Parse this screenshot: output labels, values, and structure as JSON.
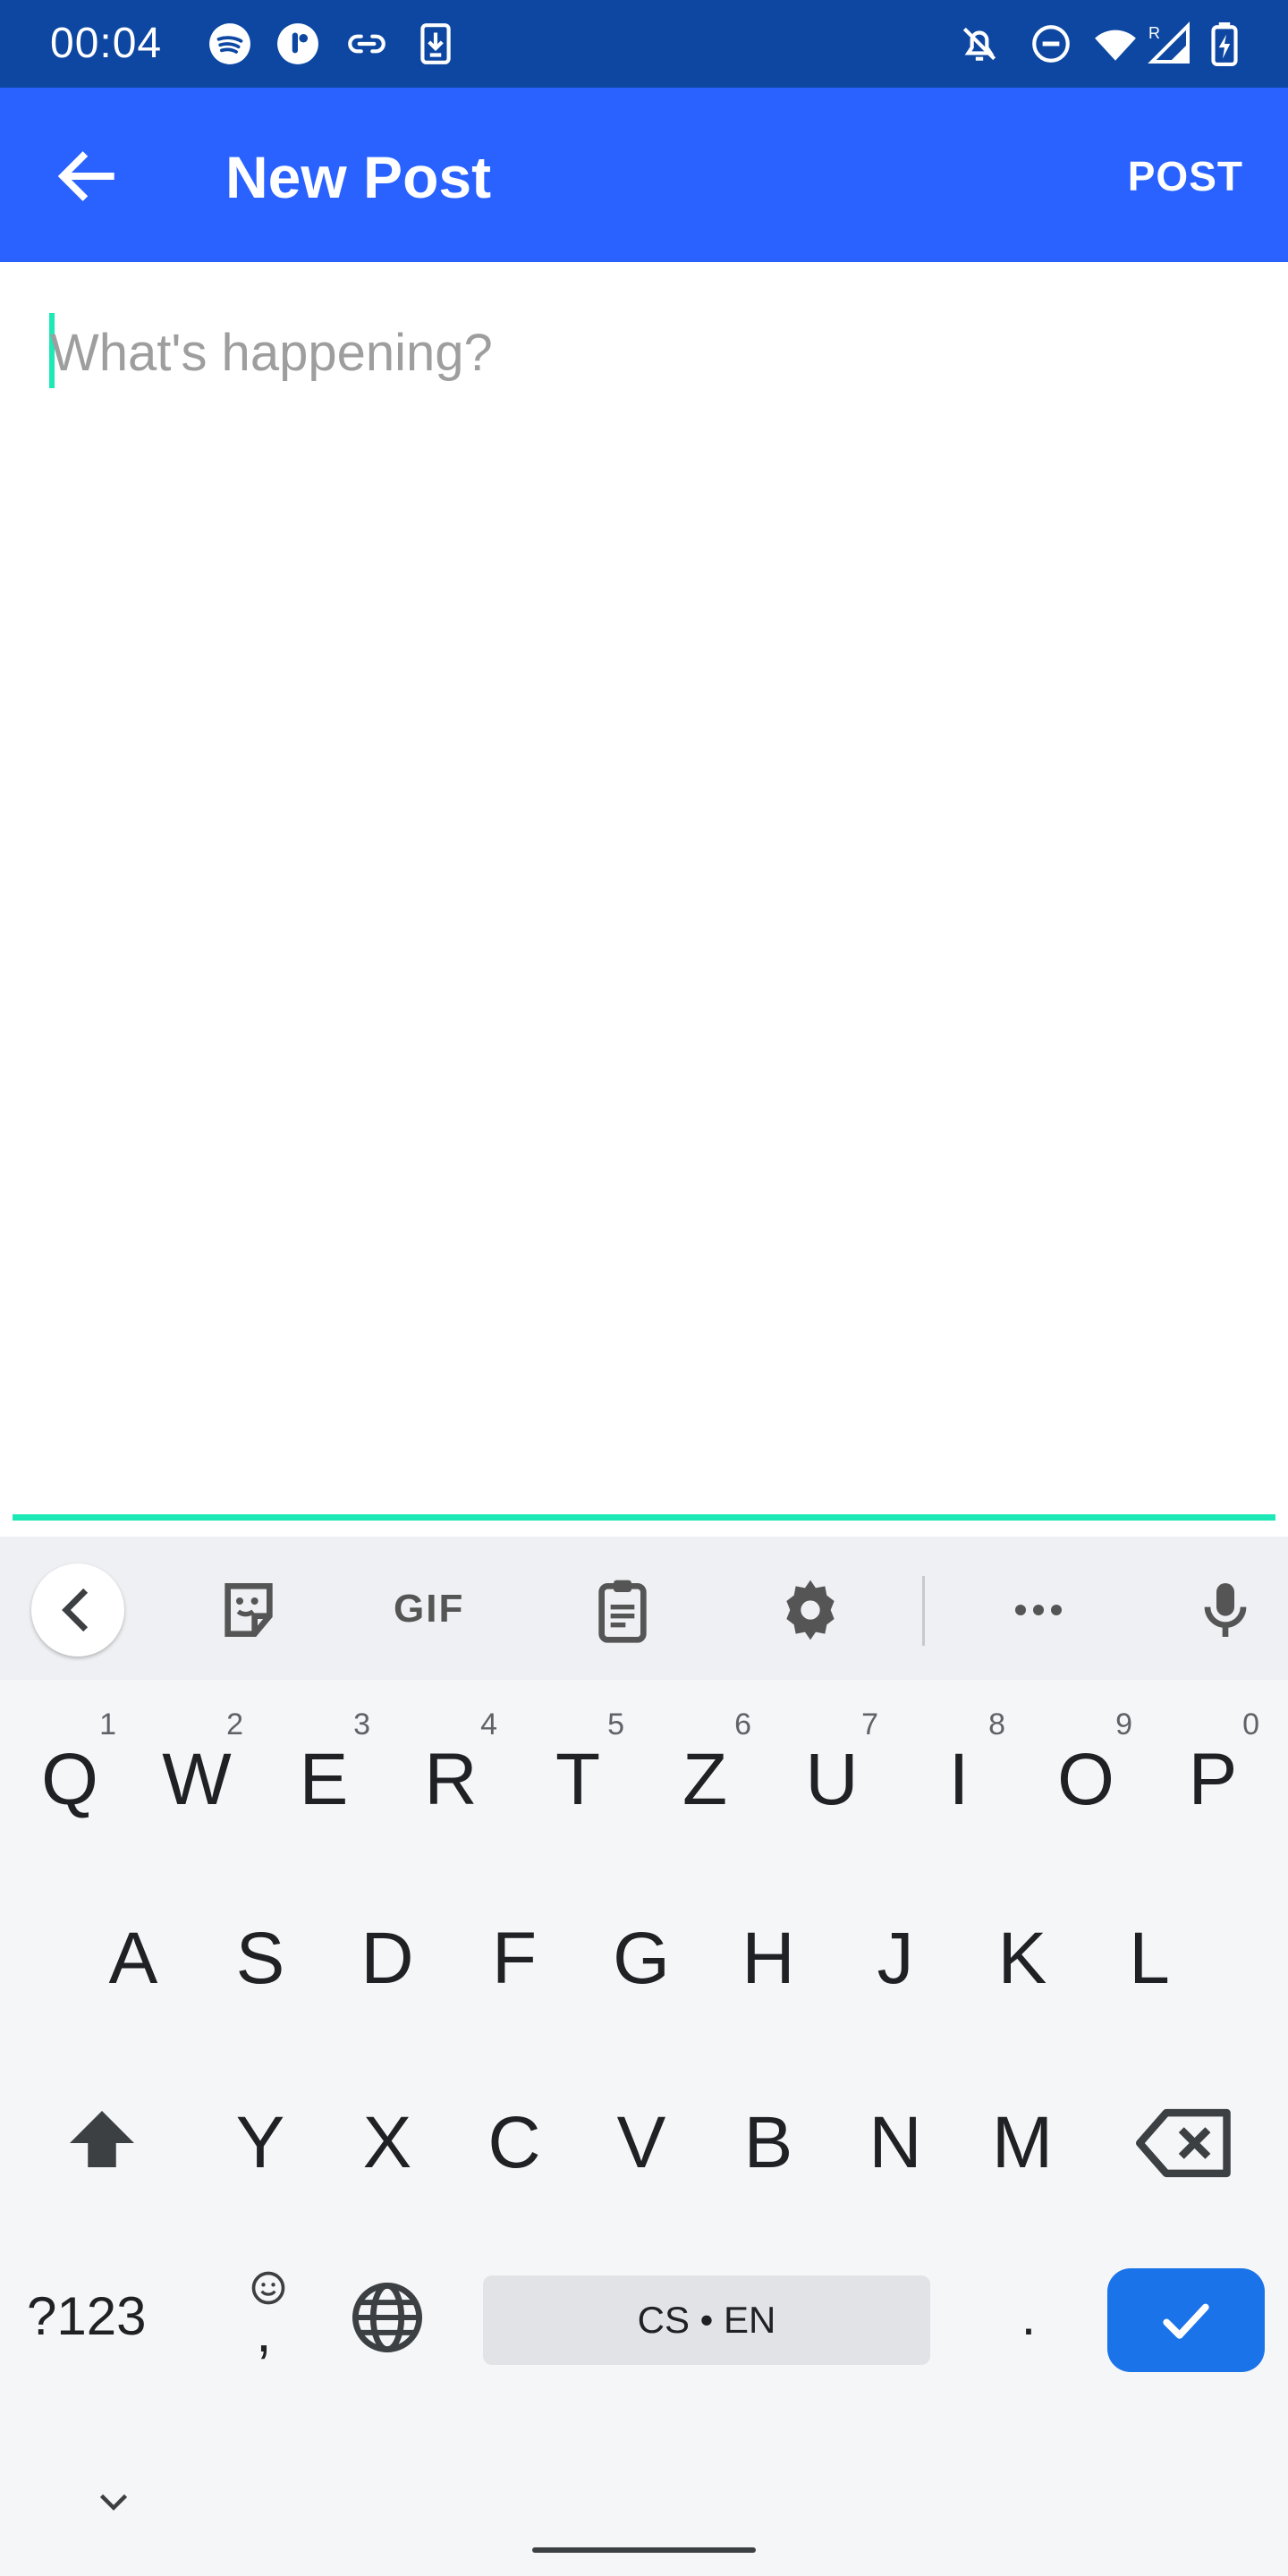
{
  "status_bar": {
    "time": "00:04",
    "icons": [
      "spotify-icon",
      "app-icon",
      "link-icon",
      "download-icon",
      "bell-off-icon",
      "do-not-disturb-icon",
      "wifi-icon",
      "signal-icon",
      "battery-charging-icon"
    ],
    "signal_roaming_label": "R"
  },
  "app_bar": {
    "title": "New Post",
    "back_icon": "arrow-back-icon",
    "post_label": "POST",
    "background": "#2962ff"
  },
  "compose": {
    "placeholder": "What's happening?",
    "accent_color": "#1de9b6"
  },
  "keyboard": {
    "toolbar": [
      "collapse-icon",
      "sticker-icon",
      "GIF",
      "clipboard-icon",
      "settings-icon",
      "more-icon",
      "mic-icon"
    ],
    "gif_label": "GIF",
    "row1": [
      {
        "letter": "Q",
        "hint": "1"
      },
      {
        "letter": "W",
        "hint": "2"
      },
      {
        "letter": "E",
        "hint": "3"
      },
      {
        "letter": "R",
        "hint": "4"
      },
      {
        "letter": "T",
        "hint": "5"
      },
      {
        "letter": "Z",
        "hint": "6"
      },
      {
        "letter": "U",
        "hint": "7"
      },
      {
        "letter": "I",
        "hint": "8"
      },
      {
        "letter": "O",
        "hint": "9"
      },
      {
        "letter": "P",
        "hint": "0"
      }
    ],
    "row2": [
      "A",
      "S",
      "D",
      "F",
      "G",
      "H",
      "J",
      "K",
      "L"
    ],
    "row3": [
      "Y",
      "X",
      "C",
      "V",
      "B",
      "N",
      "M"
    ],
    "symbols_label": "?123",
    "comma_label": ",",
    "space_label": "CS • EN",
    "period_label": ".",
    "enter_color": "#1a73e8"
  }
}
